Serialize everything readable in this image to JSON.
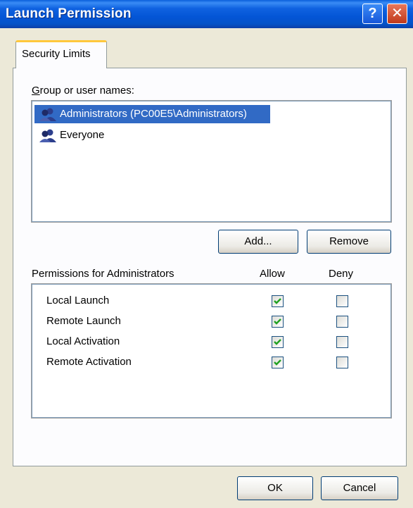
{
  "window": {
    "title": "Launch Permission"
  },
  "titlebar": {
    "help_glyph": "?",
    "close_glyph": "✕"
  },
  "tabs": [
    {
      "label": "Security Limits",
      "active": true
    }
  ],
  "groups": {
    "label": "Group or user names:",
    "items": [
      {
        "name": "Administrators (PC00E5\\Administrators)",
        "icon": "users-group-icon",
        "selected": true
      },
      {
        "name": "Everyone",
        "icon": "users-group-icon",
        "selected": false
      }
    ]
  },
  "buttons": {
    "add": "Add...",
    "remove": "Remove",
    "ok": "OK",
    "cancel": "Cancel"
  },
  "permissions": {
    "label": "Permissions for Administrators",
    "allow_header": "Allow",
    "deny_header": "Deny",
    "rows": [
      {
        "name": "Local Launch",
        "allow": true,
        "deny": false
      },
      {
        "name": "Remote Launch",
        "allow": true,
        "deny": false
      },
      {
        "name": "Local Activation",
        "allow": true,
        "deny": false
      },
      {
        "name": "Remote Activation",
        "allow": true,
        "deny": false
      }
    ]
  },
  "colors": {
    "titlebar": "#0455D6",
    "selection": "#316AC5",
    "face": "#ECE9D8",
    "check": "#21A121"
  }
}
